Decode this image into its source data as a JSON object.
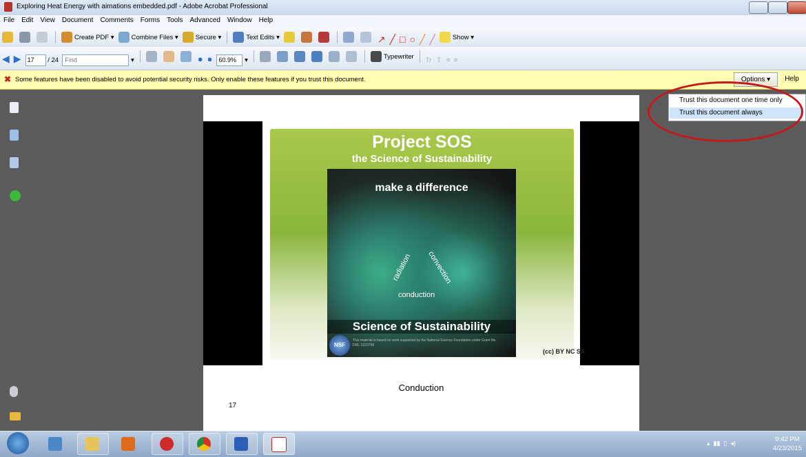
{
  "window": {
    "title": "Exploring Heat Energy with aimations embedded.pdf - Adobe Acrobat Professional"
  },
  "menu": [
    "File",
    "Edit",
    "View",
    "Document",
    "Comments",
    "Forms",
    "Tools",
    "Advanced",
    "Window",
    "Help"
  ],
  "toolbar1": {
    "create_pdf": "Create PDF",
    "combine_files": "Combine Files",
    "secure": "Secure",
    "text_edits": "Text Edits",
    "show": "Show"
  },
  "toolbar2": {
    "page_current": "17",
    "page_total": "/ 24",
    "find_placeholder": "Find",
    "zoom": "60.9%",
    "typewriter": "Typewriter"
  },
  "warning": {
    "message": "Some features have been disabled to avoid potential security risks. Only enable these features if you trust this document.",
    "options_label": "Options",
    "help_label": "Help"
  },
  "options_menu": {
    "items": [
      "Trust this document one time only",
      "Trust this document always"
    ]
  },
  "slide": {
    "title": "Project SOS",
    "subtitle": "the Science of Sustainability",
    "inner_heading": "make a difference",
    "labels": {
      "radiation": "radiation",
      "convection": "convection",
      "conduction": "conduction"
    },
    "footer": "Science of Sustainability",
    "nsf_label": "NSF",
    "credits": "This material is based on work supported by the National Science Foundation under Grant No. DRL-1223799",
    "cc_badge": "(cc) BY NC SA"
  },
  "page": {
    "caption": "Conduction",
    "number": "17"
  },
  "taskbar": {
    "time": "9:42 PM",
    "date": "4/23/2015"
  },
  "colors": {
    "warning_bg": "#fffbb0",
    "highlight_circle": "#c51818",
    "selection": "#cfe3fa"
  }
}
